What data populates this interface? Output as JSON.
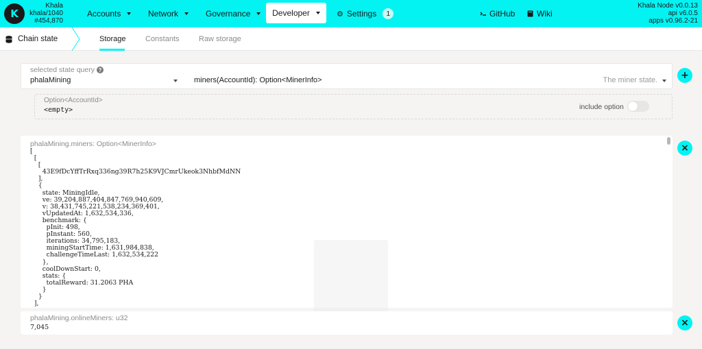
{
  "header": {
    "logo_letter": "K",
    "chain": {
      "name": "Khala",
      "runtime": "khala/1040",
      "block": "#454,870"
    },
    "nav": [
      {
        "label": "Accounts"
      },
      {
        "label": "Network"
      },
      {
        "label": "Governance"
      },
      {
        "label": "Developer"
      },
      {
        "label": "Settings",
        "badge": "1"
      }
    ],
    "links": [
      {
        "label": "GitHub"
      },
      {
        "label": "Wiki"
      }
    ],
    "node": {
      "name": "Khala Node v0.0.13",
      "api": "api v6.0.5",
      "apps": "apps v0.96.2-21"
    },
    "accent_color": "#03f3f3"
  },
  "subnav": {
    "section": "Chain state",
    "tabs": [
      {
        "label": "Storage"
      },
      {
        "label": "Constants"
      },
      {
        "label": "Raw storage"
      }
    ]
  },
  "query": {
    "label": "selected state query",
    "section": "phalaMining",
    "method": "miners(AccountId): Option<MinerInfo>",
    "description": "The miner state.",
    "add_button": "+"
  },
  "param": {
    "label": "Option<AccountId>",
    "value": "<empty>",
    "include_option": "include option"
  },
  "results": [
    {
      "label": "phalaMining.miners: Option<MinerInfo>",
      "lines": [
        "[",
        "  [",
        "    [",
        "      43E9fDcYffTrRxq336ng39R7h25K9VJCmrUkeok3NhbfMdNN",
        "    ],",
        "    {",
        "      state: MiningIdle,",
        "      ve: 39,204,887,404,847,769,940,609,",
        "      v: 38,431,745,221,538,234,369,401,",
        "      vUpdatedAt: 1,632,534,336,",
        "      benchmark: {",
        "        pInit: 498,",
        "        pInstant: 560,",
        "        iterations: 34,795,183,",
        "        miningStartTime: 1,631,984,838,",
        "        challengeTimeLast: 1,632,534,222",
        "      },",
        "      coolDownStart: 0,",
        "      stats: {",
        "        totalReward: 31.2063 PHA",
        "      }",
        "    }",
        "  ],"
      ],
      "close_button": "×"
    },
    {
      "label": "phalaMining.onlineMiners: u32",
      "value": "7,045",
      "close_button": "×"
    }
  ]
}
